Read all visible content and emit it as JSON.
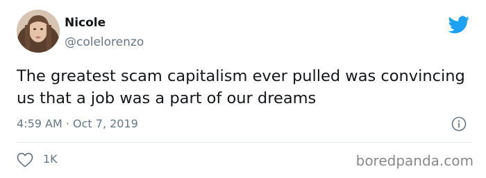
{
  "tweet": {
    "author": {
      "display_name": "Nicole",
      "handle": "@colelorenzo",
      "avatar_icon": "avatar-photo"
    },
    "text": "The greatest scam capitalism ever pulled was convincing us that a job was a part of our dreams",
    "timestamp": "4:59 AM · Oct 7, 2019",
    "likes": "1K",
    "icons": {
      "brand": "twitter-bird-icon",
      "info": "info-icon",
      "like": "heart-icon"
    },
    "colors": {
      "brand": "#1da1f2",
      "secondary_text": "#657786",
      "divider": "#e1e8ed"
    }
  },
  "watermark": "boredpanda.com"
}
